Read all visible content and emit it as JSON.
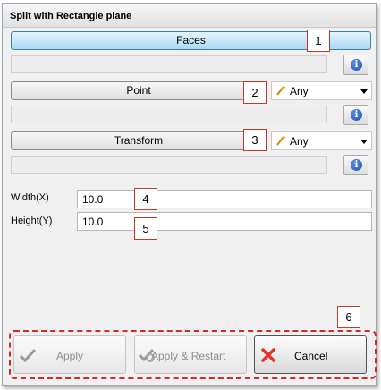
{
  "window": {
    "title": "Split with Rectangle plane"
  },
  "selectors": [
    {
      "label": "Faces",
      "marker": "1"
    },
    {
      "label": "Point",
      "marker": "2",
      "filter": "Any"
    },
    {
      "label": "Transform",
      "marker": "3",
      "filter": "Any"
    }
  ],
  "info_glyph": "i",
  "params": {
    "width_label": "Width(X)",
    "width_value": "10.0",
    "width_marker": "4",
    "height_label": "Height(Y)",
    "height_value": "10.0",
    "height_marker": "5"
  },
  "footer": {
    "marker": "6",
    "apply": "Apply",
    "apply_restart": "Apply & Restart",
    "cancel": "Cancel"
  },
  "colors": {
    "selected_button": "#a9d8f2",
    "annotation": "#d9262b",
    "info_icon": "#1d4fb3",
    "cancel_icon": "#e2322b"
  }
}
